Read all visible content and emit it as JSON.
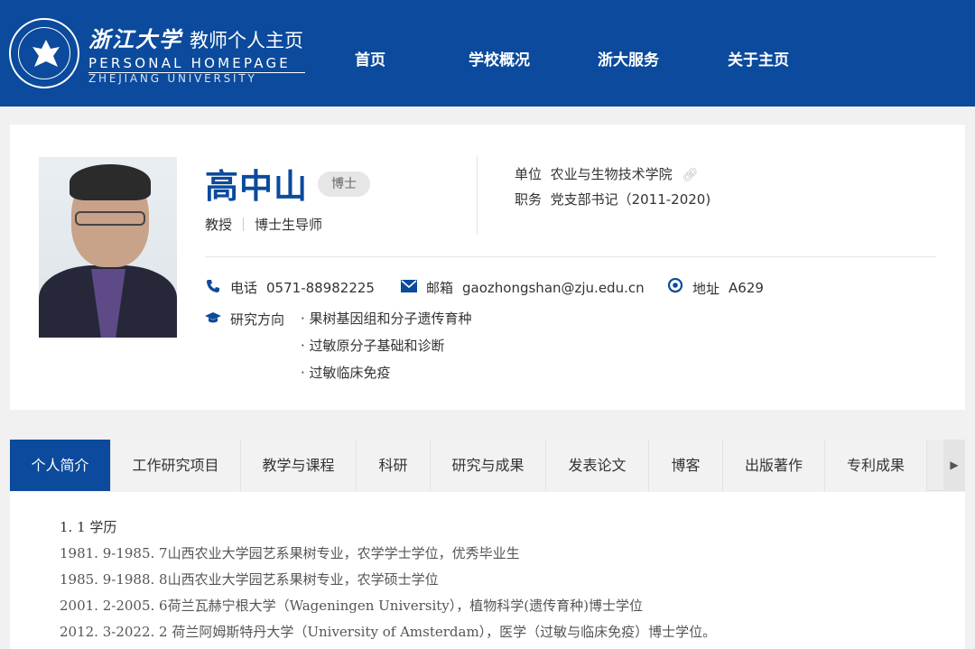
{
  "header": {
    "logo_cn": "浙江大学",
    "logo_sub": "教师个人主页",
    "logo_en1": "PERSONAL HOMEPAGE",
    "logo_en2": "ZHEJIANG UNIVERSITY",
    "nav": [
      "首页",
      "学校概况",
      "浙大服务",
      "关于主页"
    ]
  },
  "profile": {
    "name": "高中山",
    "degree": "博士",
    "title1": "教授",
    "title2": "博士生导师",
    "unit_label": "单位",
    "unit_value": "农业与生物技术学院",
    "post_label": "职务",
    "post_value": "党支部书记（2011-2020)",
    "phone_label": "电话",
    "phone": "0571-88982225",
    "email_label": "邮箱",
    "email": "gaozhongshan@zju.edu.cn",
    "addr_label": "地址",
    "addr": "A629",
    "research_label": "研究方向",
    "research": [
      "· 果树基因组和分子遗传育种",
      "· 过敏原分子基础和诊断",
      "· 过敏临床免疫"
    ]
  },
  "tabs": [
    "个人简介",
    "工作研究项目",
    "教学与课程",
    "科研",
    "研究与成果",
    "发表论文",
    "博客",
    "出版著作",
    "专利成果"
  ],
  "active_tab": "个人简介",
  "content": {
    "heading": "1. 1 学历",
    "lines": [
      "1981. 9-1985. 7山西农业大学园艺系果树专业，农学学士学位，优秀毕业生",
      "1985. 9-1988. 8山西农业大学园艺系果树专业，农学硕士学位",
      "2001. 2-2005. 6荷兰瓦赫宁根大学（Wageningen University），植物科学(遗传育种)博士学位",
      "2012. 3-2022. 2 荷兰阿姆斯特丹大学（University of Amsterdam），医学（过敏与临床免疫）博士学位。"
    ]
  },
  "colors": {
    "brand": "#0b4a9c",
    "page_bg": "#f1f1f1"
  },
  "icons": [
    "zju-seal-icon",
    "link-icon",
    "phone-icon",
    "mail-icon",
    "location-icon",
    "graduation-cap-icon",
    "chevron-right-icon"
  ]
}
